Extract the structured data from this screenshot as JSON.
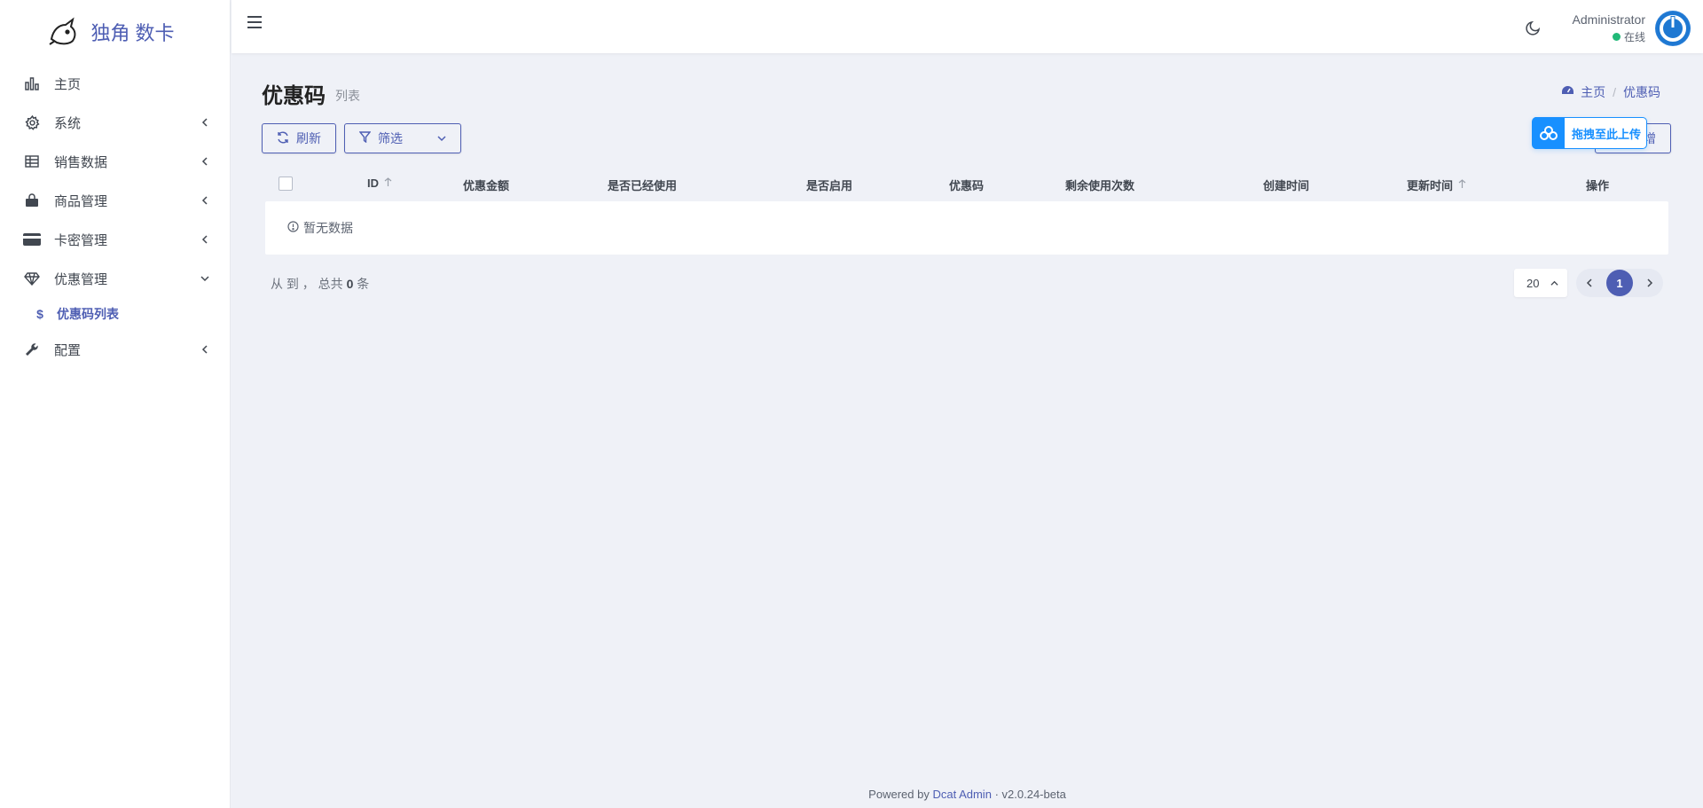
{
  "brand": {
    "name": "独角 数卡"
  },
  "colors": {
    "accent": "#4e5eb3",
    "online": "#21b978",
    "upload": "#1890ff"
  },
  "sidebar": {
    "items": [
      {
        "label": "主页",
        "icon": "bar-chart-icon"
      },
      {
        "label": "系统",
        "icon": "gear-icon"
      },
      {
        "label": "销售数据",
        "icon": "table-icon"
      },
      {
        "label": "商品管理",
        "icon": "bag-icon"
      },
      {
        "label": "卡密管理",
        "icon": "card-icon"
      },
      {
        "label": "优惠管理",
        "icon": "diamond-icon"
      },
      {
        "label": "配置",
        "icon": "wrench-icon"
      }
    ],
    "sub_item": {
      "label": "优惠码列表",
      "icon_glyph": "$"
    }
  },
  "header": {
    "user_name": "Administrator",
    "user_status": "在线"
  },
  "page": {
    "title": "优惠码",
    "subtitle": "列表",
    "breadcrumb": [
      "主页",
      "优惠码"
    ]
  },
  "toolbar": {
    "refresh_label": "刷新",
    "filter_label": "筛选",
    "new_label_partial": "增",
    "upload_badge": "拖拽至此上传"
  },
  "table": {
    "columns": [
      "ID",
      "优惠金额",
      "是否已经使用",
      "是否启用",
      "优惠码",
      "剩余使用次数",
      "创建时间",
      "更新时间",
      "操作"
    ],
    "empty_text": "暂无数据"
  },
  "pagination": {
    "summary_prefix": "从 到 ， 总共",
    "total": "0",
    "summary_suffix": "条",
    "per_page": "20",
    "current_page": "1"
  },
  "footer": {
    "powered_by": "Powered by",
    "link": "Dcat Admin",
    "separator": "·",
    "version": "v2.0.24-beta"
  }
}
